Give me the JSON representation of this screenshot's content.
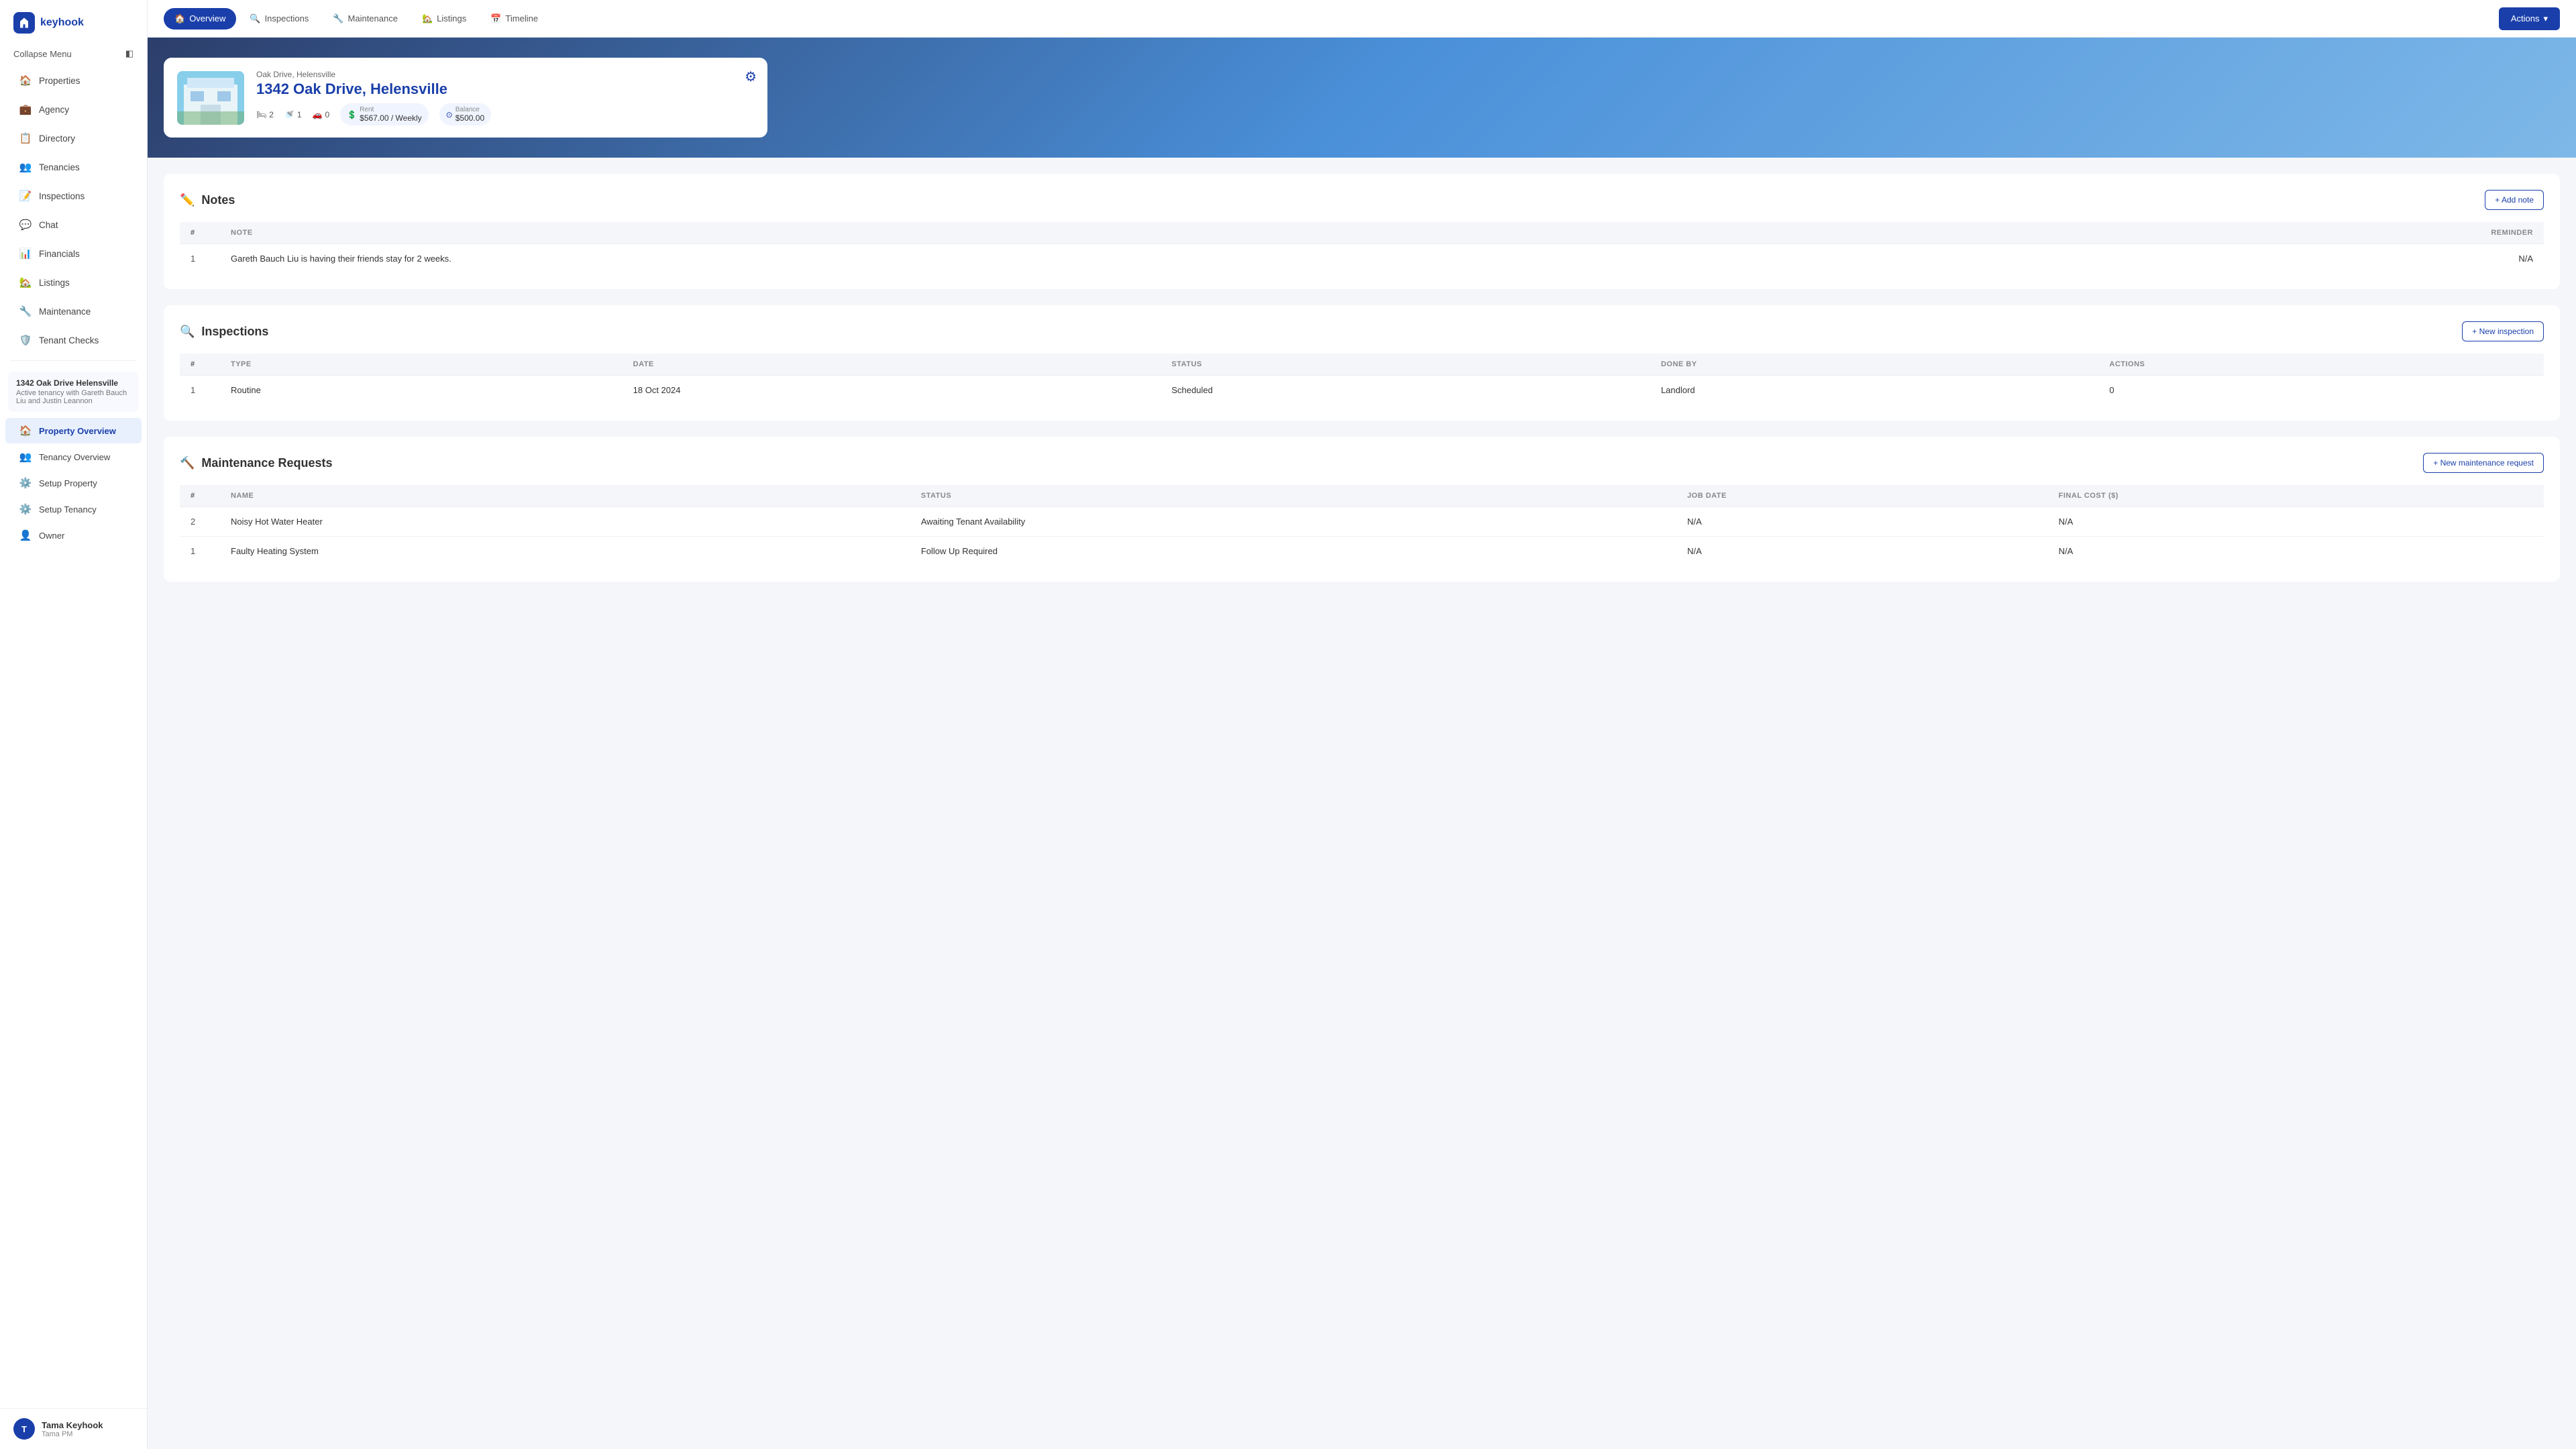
{
  "app": {
    "name": "keyhook",
    "logo_icon": "🏠"
  },
  "sidebar": {
    "collapse_label": "Collapse Menu",
    "nav_items": [
      {
        "id": "properties",
        "label": "Properties",
        "icon": "🏠"
      },
      {
        "id": "agency",
        "label": "Agency",
        "icon": "💼"
      },
      {
        "id": "directory",
        "label": "Directory",
        "icon": "📋"
      },
      {
        "id": "tenancies",
        "label": "Tenancies",
        "icon": "👥"
      },
      {
        "id": "inspections",
        "label": "Inspections",
        "icon": "📝"
      },
      {
        "id": "chat",
        "label": "Chat",
        "icon": "💬"
      },
      {
        "id": "financials",
        "label": "Financials",
        "icon": "📊"
      },
      {
        "id": "listings",
        "label": "Listings",
        "icon": "🏡"
      },
      {
        "id": "maintenance",
        "label": "Maintenance",
        "icon": "🔧"
      },
      {
        "id": "tenant-checks",
        "label": "Tenant Checks",
        "icon": "🛡️"
      }
    ],
    "tenancy_card": {
      "address": "1342 Oak Drive Helensville",
      "info": "Active tenancy with Gareth Bauch Liu and Justin Leannon"
    },
    "sub_nav_items": [
      {
        "id": "property-overview",
        "label": "Property Overview",
        "icon": "🏠",
        "active": true
      },
      {
        "id": "tenancy-overview",
        "label": "Tenancy Overview",
        "icon": "👥"
      },
      {
        "id": "setup-property",
        "label": "Setup Property",
        "icon": "⚙️"
      },
      {
        "id": "setup-tenancy",
        "label": "Setup Tenancy",
        "icon": "⚙️"
      },
      {
        "id": "owner",
        "label": "Owner",
        "icon": "👤"
      }
    ],
    "user": {
      "name": "Tama Keyhook",
      "role": "Tama PM",
      "initials": "T"
    }
  },
  "topnav": {
    "tabs": [
      {
        "id": "overview",
        "label": "Overview",
        "icon": "🏠",
        "active": true
      },
      {
        "id": "inspections",
        "label": "Inspections",
        "icon": "🔍"
      },
      {
        "id": "maintenance",
        "label": "Maintenance",
        "icon": "🔧"
      },
      {
        "id": "listings",
        "label": "Listings",
        "icon": "🏡"
      },
      {
        "id": "timeline",
        "label": "Timeline",
        "icon": "📅"
      }
    ],
    "actions_label": "Actions"
  },
  "hero": {
    "street": "Oak Drive, Helensville",
    "address": "1342 Oak Drive, Helensville",
    "beds": "2",
    "baths": "1",
    "parking": "0",
    "rent_label": "Rent",
    "rent_value": "$567.00 / Weekly",
    "balance_label": "Balance",
    "balance_value": "$500.00"
  },
  "notes_section": {
    "title": "Notes",
    "add_button": "+ Add note",
    "columns": [
      "#",
      "NOTE",
      "REMINDER"
    ],
    "rows": [
      {
        "num": "1",
        "note": "Gareth Bauch Liu is having their friends stay for 2 weeks.",
        "reminder": "N/A"
      }
    ]
  },
  "inspections_section": {
    "title": "Inspections",
    "add_button": "+ New inspection",
    "columns": [
      "#",
      "TYPE",
      "DATE",
      "STATUS",
      "DONE BY",
      "ACTIONS"
    ],
    "rows": [
      {
        "num": "1",
        "type": "Routine",
        "date": "18 Oct 2024",
        "status": "Scheduled",
        "done_by": "Landlord",
        "actions": "0"
      }
    ]
  },
  "maintenance_section": {
    "title": "Maintenance Requests",
    "add_button": "+ New maintenance request",
    "columns": [
      "#",
      "NAME",
      "STATUS",
      "JOB DATE",
      "FINAL COST ($)"
    ],
    "rows": [
      {
        "num": "2",
        "name": "Noisy Hot Water Heater",
        "status": "Awaiting Tenant Availability",
        "job_date": "N/A",
        "final_cost": "N/A"
      },
      {
        "num": "1",
        "name": "Faulty Heating System",
        "status": "Follow Up Required",
        "job_date": "N/A",
        "final_cost": "N/A"
      }
    ]
  }
}
